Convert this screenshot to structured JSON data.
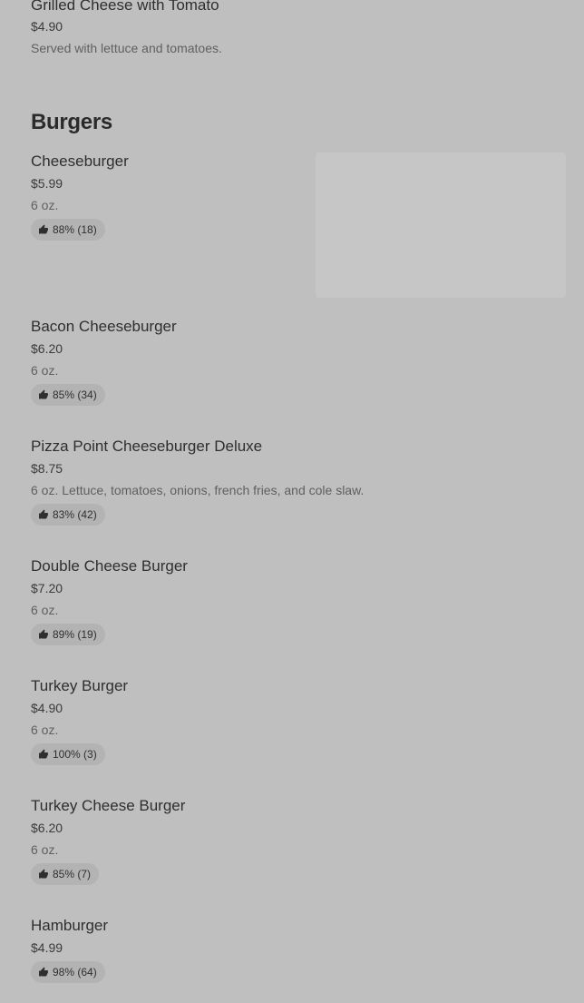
{
  "top_item": {
    "name": "Grilled Cheese with Tomato",
    "price": "$4.90",
    "description": "Served with lettuce and tomatoes."
  },
  "section": {
    "title": "Burgers"
  },
  "items": [
    {
      "name": "Cheeseburger",
      "price": "$5.99",
      "description": "6 oz.",
      "rating": "88% (18)"
    },
    {
      "name": "Bacon Cheeseburger",
      "price": "$6.20",
      "description": "6 oz.",
      "rating": "85% (34)"
    },
    {
      "name": "Pizza Point Cheeseburger Deluxe",
      "price": "$8.75",
      "description": "6 oz. Lettuce, tomatoes, onions, french fries, and cole slaw.",
      "rating": "83% (42)"
    },
    {
      "name": "Double Cheese Burger",
      "price": "$7.20",
      "description": "6 oz.",
      "rating": "89% (19)"
    },
    {
      "name": "Turkey Burger",
      "price": "$4.90",
      "description": "6 oz.",
      "rating": "100% (3)"
    },
    {
      "name": "Turkey Cheese Burger",
      "price": "$6.20",
      "description": "6 oz.",
      "rating": "85% (7)"
    },
    {
      "name": "Hamburger",
      "price": "$4.99",
      "description": "",
      "rating": "98% (64)"
    }
  ],
  "icons": {
    "rating": "thumbs-up-icon"
  }
}
